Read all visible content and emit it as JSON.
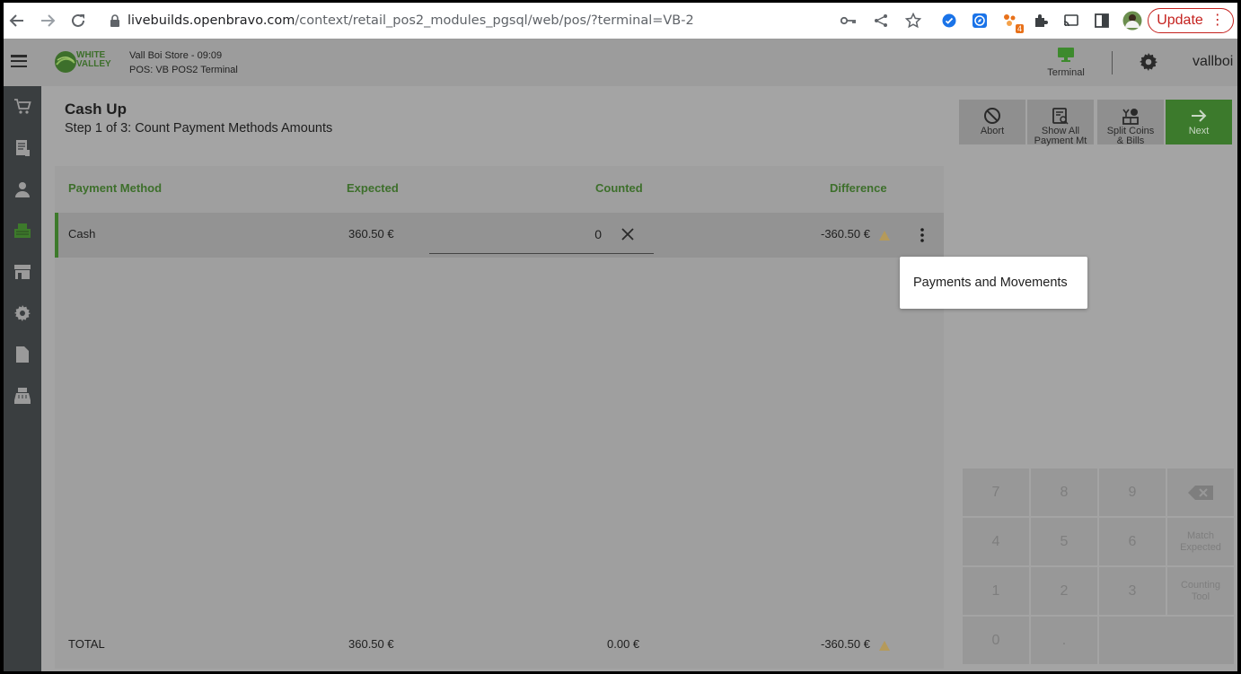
{
  "browser": {
    "url_host": "livebuilds.openbravo.com",
    "url_path": "/context/retail_pos2_modules_pgsql/web/pos/?terminal=VB-2",
    "update_label": "Update",
    "extension_badge": "4"
  },
  "header": {
    "logo_line1": "WHITE",
    "logo_line2": "VALLEY",
    "store_line": "Vall Boi Store - 09:09",
    "pos_line": "POS: VB POS2 Terminal",
    "terminal_label": "Terminal",
    "username": "vallboi"
  },
  "page": {
    "title": "Cash Up",
    "subtitle": "Step 1 of 3: Count Payment Methods Amounts"
  },
  "actions": [
    {
      "label_line1": "Abort",
      "label_line2": ""
    },
    {
      "label_line1": "Show All",
      "label_line2": "Payment Mt"
    },
    {
      "label_line1": "Split Coins",
      "label_line2": "& Bills"
    },
    {
      "label_line1": "Next",
      "label_line2": ""
    }
  ],
  "table": {
    "headers": {
      "method": "Payment Method",
      "expected": "Expected",
      "counted": "Counted",
      "difference": "Difference"
    },
    "row": {
      "method": "Cash",
      "expected": "360.50 €",
      "counted": "0",
      "difference": "-360.50 €"
    },
    "total": {
      "label": "TOTAL",
      "expected": "360.50 €",
      "counted": "0.00 €",
      "difference": "-360.50 €"
    }
  },
  "popup": {
    "item": "Payments and Movements"
  },
  "keypad": {
    "k7": "7",
    "k8": "8",
    "k9": "9",
    "k4": "4",
    "k5": "5",
    "k6": "6",
    "k1": "1",
    "k2": "2",
    "k3": "3",
    "k0": "0",
    "kdot": ".",
    "match_line1": "Match",
    "match_line2": "Expected",
    "counting_line1": "Counting",
    "counting_line2": "Tool"
  },
  "colors": {
    "brand_green": "#3d7a2b",
    "warning": "#e8a317"
  }
}
